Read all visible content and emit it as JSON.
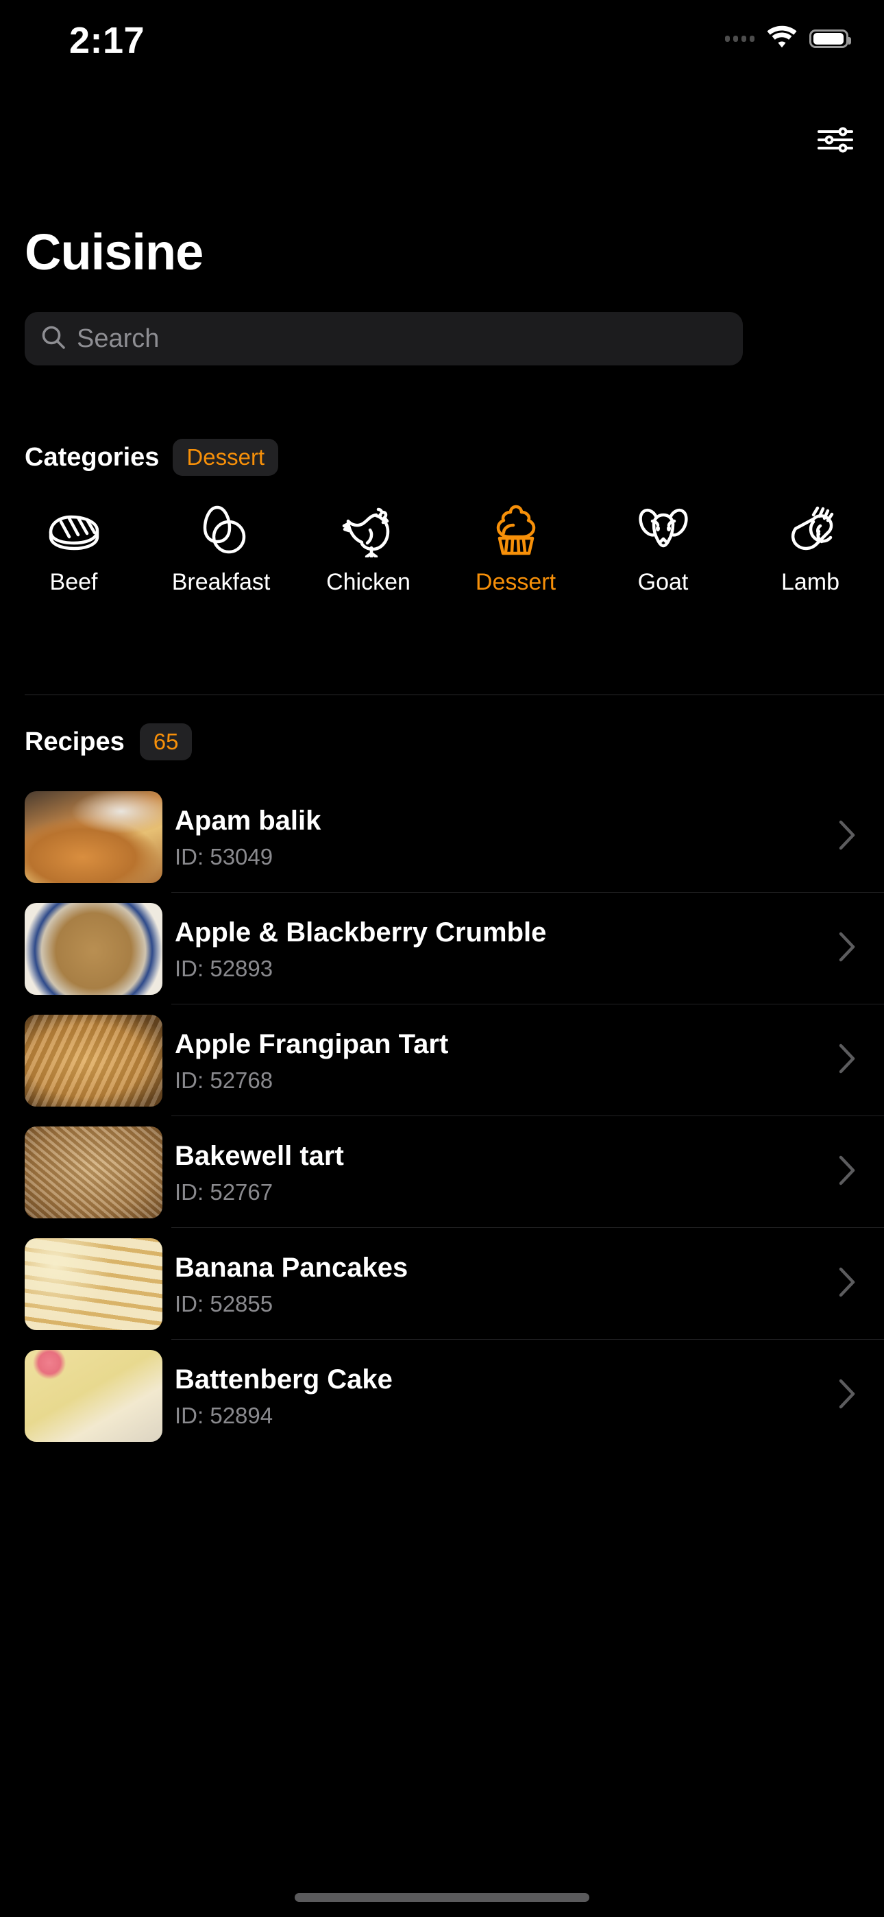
{
  "status_bar": {
    "time": "2:17",
    "cellular_icon": "cellular-dots-icon",
    "wifi_icon": "wifi-icon",
    "battery_icon": "battery-icon"
  },
  "nav": {
    "filter_icon": "sliders-filter-icon"
  },
  "header": {
    "title": "Cuisine"
  },
  "search": {
    "icon": "search-icon",
    "placeholder": "Search",
    "value": ""
  },
  "categories_section": {
    "label": "Categories",
    "selected_badge": "Dessert",
    "items": [
      {
        "label": "Beef",
        "icon": "steak-icon",
        "selected": false
      },
      {
        "label": "Breakfast",
        "icon": "eggs-icon",
        "selected": false
      },
      {
        "label": "Chicken",
        "icon": "chicken-icon",
        "selected": false
      },
      {
        "label": "Dessert",
        "icon": "cupcake-icon",
        "selected": true
      },
      {
        "label": "Goat",
        "icon": "goat-head-icon",
        "selected": false
      },
      {
        "label": "Lamb",
        "icon": "lamb-chop-icon",
        "selected": false
      }
    ]
  },
  "recipes_section": {
    "label": "Recipes",
    "count": "65",
    "id_prefix": "ID: ",
    "chevron_icon": "chevron-right-icon",
    "items": [
      {
        "name": "Apam balik",
        "id": "ID: 53049"
      },
      {
        "name": "Apple & Blackberry Crumble",
        "id": "ID: 52893"
      },
      {
        "name": "Apple Frangipan Tart",
        "id": "ID: 52768"
      },
      {
        "name": "Bakewell tart",
        "id": "ID: 52767"
      },
      {
        "name": "Banana Pancakes",
        "id": "ID: 52855"
      },
      {
        "name": "Battenberg Cake",
        "id": "ID: 52894"
      }
    ]
  },
  "colors": {
    "background": "#000000",
    "accent": "#f79009",
    "field": "#1c1c1e",
    "badge": "#222224",
    "secondary_text": "#8a8a8e",
    "separator": "#232325"
  },
  "home_indicator": "home-indicator"
}
